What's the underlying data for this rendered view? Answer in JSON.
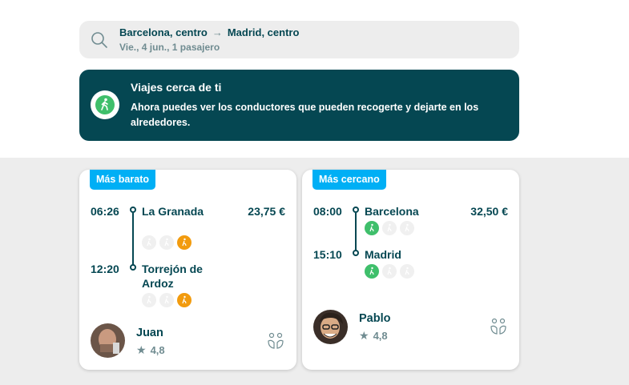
{
  "search": {
    "from": "Barcelona, centro",
    "to": "Madrid, centro",
    "details": "Vie., 4 jun., 1 pasajero",
    "icon": "search-icon"
  },
  "banner": {
    "title": "Viajes cerca de ti",
    "text": "Ahora puedes ver los conductores que pueden recogerte y dejarte en los alrededores.",
    "icon": "walking-person-icon",
    "color": "#054752"
  },
  "trips": [
    {
      "tag": "Más barato",
      "departure_time": "06:26",
      "departure_place": "La Granada",
      "arrival_time": "12:20",
      "arrival_place": "Torrejón de Ardoz",
      "price": "23,75 €",
      "driver": "Juan",
      "rating": "4,8"
    },
    {
      "tag": "Más cercano",
      "departure_time": "08:00",
      "departure_place": "Barcelona",
      "arrival_time": "15:10",
      "arrival_place": "Madrid",
      "price": "32,50 €",
      "driver": "Pablo",
      "rating": "4,8"
    }
  ],
  "colors": {
    "primary": "#054752",
    "accent": "#00aff5",
    "walk_far": "#f29b0e",
    "walk_near": "#3fbf6b",
    "muted": "#708c91"
  }
}
